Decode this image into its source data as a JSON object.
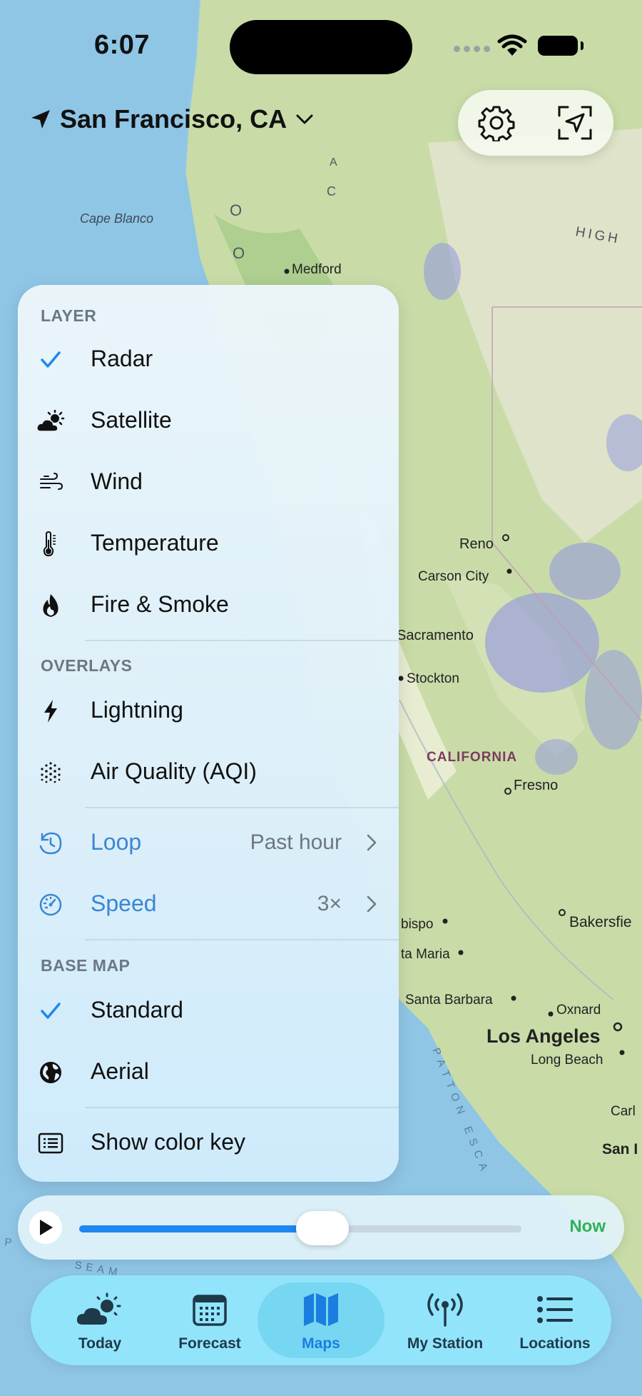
{
  "status_bar": {
    "time": "6:07"
  },
  "location": {
    "name": "San Francisco, CA"
  },
  "map": {
    "labels": [
      "Cape Blanco",
      "Medford",
      "HIGH",
      "Reno",
      "Carson City",
      "Sacramento",
      "Stockton",
      "CALIFORNIA",
      "Fresno",
      "bispo",
      "ta Maria",
      "Bakersfie",
      "Santa Barbara",
      "Oxnard",
      "Los Angeles",
      "Long Beach",
      "Carl",
      "San I",
      "PATTON ESCA",
      "P",
      "SEAM",
      "O",
      "O",
      "C",
      "A"
    ]
  },
  "menu": {
    "layer_header": "LAYER",
    "layers": [
      {
        "label": "Radar",
        "icon": "checkmark-icon",
        "selected": true
      },
      {
        "label": "Satellite",
        "icon": "cloud-sun-icon"
      },
      {
        "label": "Wind",
        "icon": "wind-icon"
      },
      {
        "label": "Temperature",
        "icon": "thermometer-icon"
      },
      {
        "label": "Fire & Smoke",
        "icon": "flame-icon"
      }
    ],
    "overlays_header": "OVERLAYS",
    "overlays": [
      {
        "label": "Lightning",
        "icon": "bolt-icon"
      },
      {
        "label": "Air Quality (AQI)",
        "icon": "dots-icon"
      }
    ],
    "loop": {
      "label": "Loop",
      "value": "Past hour",
      "icon": "clock-arrow-icon"
    },
    "speed": {
      "label": "Speed",
      "value": "3×",
      "icon": "speedometer-icon"
    },
    "base_map_header": "BASE MAP",
    "base_maps": [
      {
        "label": "Standard",
        "icon": "checkmark-icon",
        "selected": true
      },
      {
        "label": "Aerial",
        "icon": "globe-icon"
      }
    ],
    "color_key": {
      "label": "Show color key",
      "icon": "list-card-icon"
    }
  },
  "scrubber": {
    "now_label": "Now",
    "progress": 0.55
  },
  "tabs": [
    {
      "label": "Today",
      "icon": "cloud-sun-icon"
    },
    {
      "label": "Forecast",
      "icon": "calendar-icon"
    },
    {
      "label": "Maps",
      "icon": "map-icon",
      "active": true
    },
    {
      "label": "My Station",
      "icon": "antenna-icon"
    },
    {
      "label": "Locations",
      "icon": "list-icon"
    }
  ],
  "colors": {
    "accent": "#1e87f0",
    "now_green": "#2fb156",
    "tabbar": "#92e6fc"
  }
}
